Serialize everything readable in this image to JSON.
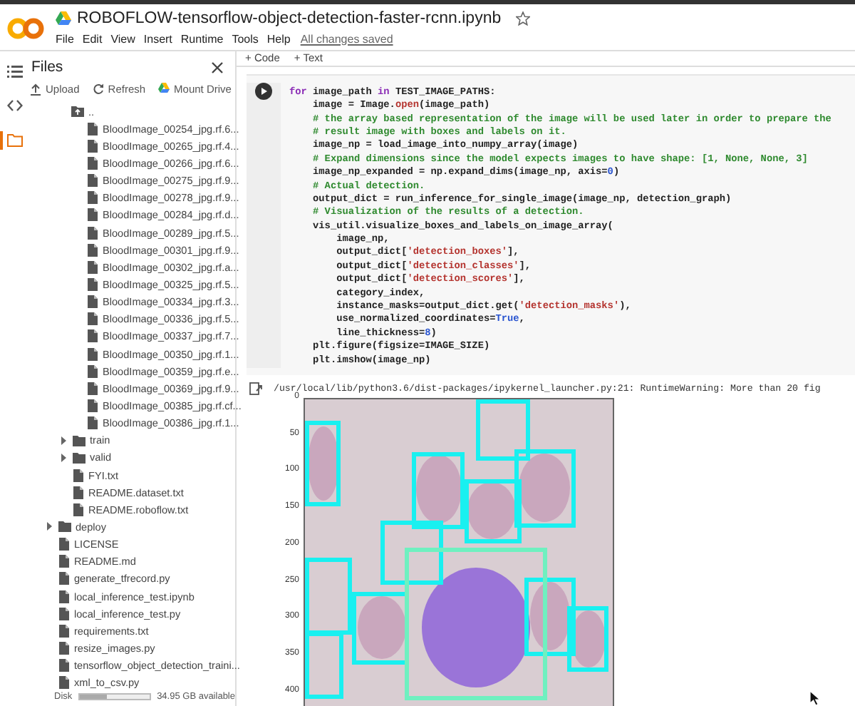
{
  "header": {
    "title": "ROBOFLOW-tensorflow-object-detection-faster-rcnn.ipynb",
    "menu": [
      "File",
      "Edit",
      "View",
      "Insert",
      "Runtime",
      "Tools",
      "Help"
    ],
    "save_status": "All changes saved"
  },
  "toolbar": {
    "buttons": [
      "+ Code",
      "+ Text"
    ]
  },
  "icon_rail": [
    {
      "kind": "toc",
      "selected": false
    },
    {
      "kind": "code",
      "selected": false
    },
    {
      "kind": "files",
      "selected": true
    }
  ],
  "sidebar": {
    "title": "Files",
    "actions": [
      {
        "kind": "upload",
        "label": "Upload"
      },
      {
        "kind": "refresh",
        "label": "Refresh"
      },
      {
        "kind": "drive",
        "label": "Mount Drive"
      }
    ],
    "parent_label": "..",
    "tree": [
      {
        "kind": "hidden",
        "children": [
          {
            "kind": "hidden",
            "children": [
              {
                "kind": "file",
                "name": "BloodImage_00254_jpg.rf.6..."
              },
              {
                "kind": "file",
                "name": "BloodImage_00265_jpg.rf.4..."
              },
              {
                "kind": "file",
                "name": "BloodImage_00266_jpg.rf.6..."
              },
              {
                "kind": "file",
                "name": "BloodImage_00275_jpg.rf.9..."
              },
              {
                "kind": "file",
                "name": "BloodImage_00278_jpg.rf.9..."
              },
              {
                "kind": "file",
                "name": "BloodImage_00284_jpg.rf.d..."
              },
              {
                "kind": "file",
                "name": "BloodImage_00289_jpg.rf.5..."
              },
              {
                "kind": "file",
                "name": "BloodImage_00301_jpg.rf.9..."
              },
              {
                "kind": "file",
                "name": "BloodImage_00302_jpg.rf.a..."
              },
              {
                "kind": "file",
                "name": "BloodImage_00325_jpg.rf.5..."
              },
              {
                "kind": "file",
                "name": "BloodImage_00334_jpg.rf.3..."
              },
              {
                "kind": "file",
                "name": "BloodImage_00336_jpg.rf.5..."
              },
              {
                "kind": "file",
                "name": "BloodImage_00337_jpg.rf.7..."
              },
              {
                "kind": "file",
                "name": "BloodImage_00350_jpg.rf.1..."
              },
              {
                "kind": "file",
                "name": "BloodImage_00359_jpg.rf.e..."
              },
              {
                "kind": "file",
                "name": "BloodImage_00369_jpg.rf.9..."
              },
              {
                "kind": "file",
                "name": "BloodImage_00385_jpg.rf.cf..."
              },
              {
                "kind": "file",
                "name": "BloodImage_00386_jpg.rf.1..."
              }
            ]
          },
          {
            "kind": "folder",
            "name": "train",
            "expanded": false
          },
          {
            "kind": "folder",
            "name": "valid",
            "expanded": false
          },
          {
            "kind": "file",
            "name": "FYI.txt"
          },
          {
            "kind": "file",
            "name": "README.dataset.txt"
          },
          {
            "kind": "file",
            "name": "README.roboflow.txt"
          }
        ]
      },
      {
        "kind": "folder",
        "name": "deploy",
        "expanded": false
      },
      {
        "kind": "file",
        "name": "LICENSE"
      },
      {
        "kind": "file",
        "name": "README.md"
      },
      {
        "kind": "file",
        "name": "generate_tfrecord.py"
      },
      {
        "kind": "file",
        "name": "local_inference_test.ipynb"
      },
      {
        "kind": "file",
        "name": "local_inference_test.py"
      },
      {
        "kind": "file",
        "name": "requirements.txt"
      },
      {
        "kind": "file",
        "name": "resize_images.py"
      },
      {
        "kind": "file",
        "name": "tensorflow_object_detection_traini..."
      },
      {
        "kind": "file",
        "name": "xml_to_csv.py"
      }
    ],
    "disk": {
      "label": "Disk",
      "level": 0.4,
      "reading": "34.95 GB available"
    }
  },
  "cell": {
    "lines": [
      [
        {
          "kind": "keyword",
          "text": "for"
        },
        {
          "kind": "plain",
          "text": " image_path "
        },
        {
          "kind": "keyword",
          "text": "in"
        },
        {
          "kind": "plain",
          "text": " TEST_IMAGE_PATHS:"
        }
      ],
      [
        {
          "kind": "plain",
          "text": "    image = Image."
        },
        {
          "kind": "string",
          "text": "open"
        },
        {
          "kind": "plain",
          "text": "(image_path)"
        }
      ],
      [
        {
          "kind": "comment",
          "text": "    # the array based representation of the image will be used later in order to prepare the"
        }
      ],
      [
        {
          "kind": "comment",
          "text": "    # result image with boxes and labels on it."
        }
      ],
      [
        {
          "kind": "plain",
          "text": "    image_np = load_image_into_numpy_array(image)"
        }
      ],
      [
        {
          "kind": "comment",
          "text": "    # Expand dimensions since the model expects images to have shape: [1, None, None, 3]"
        }
      ],
      [
        {
          "kind": "plain",
          "text": "    image_np_expanded = np.expand_dims(image_np, axis="
        },
        {
          "kind": "number",
          "text": "0"
        },
        {
          "kind": "plain",
          "text": ")"
        }
      ],
      [
        {
          "kind": "comment",
          "text": "    # Actual detection."
        }
      ],
      [
        {
          "kind": "plain",
          "text": "    output_dict = run_inference_for_single_image(image_np, detection_graph)"
        }
      ],
      [
        {
          "kind": "comment",
          "text": "    # Visualization of the results of a detection."
        }
      ],
      [
        {
          "kind": "plain",
          "text": "    vis_util.visualize_boxes_and_labels_on_image_array("
        }
      ],
      [
        {
          "kind": "plain",
          "text": "        image_np,"
        }
      ],
      [
        {
          "kind": "plain",
          "text": "        output_dict["
        },
        {
          "kind": "string",
          "text": "'detection_boxes'"
        },
        {
          "kind": "plain",
          "text": "],"
        }
      ],
      [
        {
          "kind": "plain",
          "text": "        output_dict["
        },
        {
          "kind": "string",
          "text": "'detection_classes'"
        },
        {
          "kind": "plain",
          "text": "],"
        }
      ],
      [
        {
          "kind": "plain",
          "text": "        output_dict["
        },
        {
          "kind": "string",
          "text": "'detection_scores'"
        },
        {
          "kind": "plain",
          "text": "],"
        }
      ],
      [
        {
          "kind": "plain",
          "text": "        category_index,"
        }
      ],
      [
        {
          "kind": "plain",
          "text": "        instance_masks=output_dict.get("
        },
        {
          "kind": "string",
          "text": "'detection_masks'"
        },
        {
          "kind": "plain",
          "text": "),"
        }
      ],
      [
        {
          "kind": "plain",
          "text": "        use_normalized_coordinates="
        },
        {
          "kind": "number",
          "text": "True"
        },
        {
          "kind": "plain",
          "text": ","
        }
      ],
      [
        {
          "kind": "plain",
          "text": "        line_thickness="
        },
        {
          "kind": "number",
          "text": "8"
        },
        {
          "kind": "plain",
          "text": ")"
        }
      ],
      [
        {
          "kind": "plain",
          "text": "    plt.figure(figsize=IMAGE_SIZE)"
        }
      ],
      [
        {
          "kind": "plain",
          "text": "    plt.imshow(image_np)"
        }
      ]
    ]
  },
  "output": {
    "warning": "/usr/local/lib/python3.6/dist-packages/ipykernel_launcher.py:21: RuntimeWarning: More than 20 fig",
    "plot": {
      "yticks": [
        "0",
        "50",
        "100",
        "150",
        "200",
        "250",
        "300",
        "350",
        "400"
      ]
    }
  }
}
